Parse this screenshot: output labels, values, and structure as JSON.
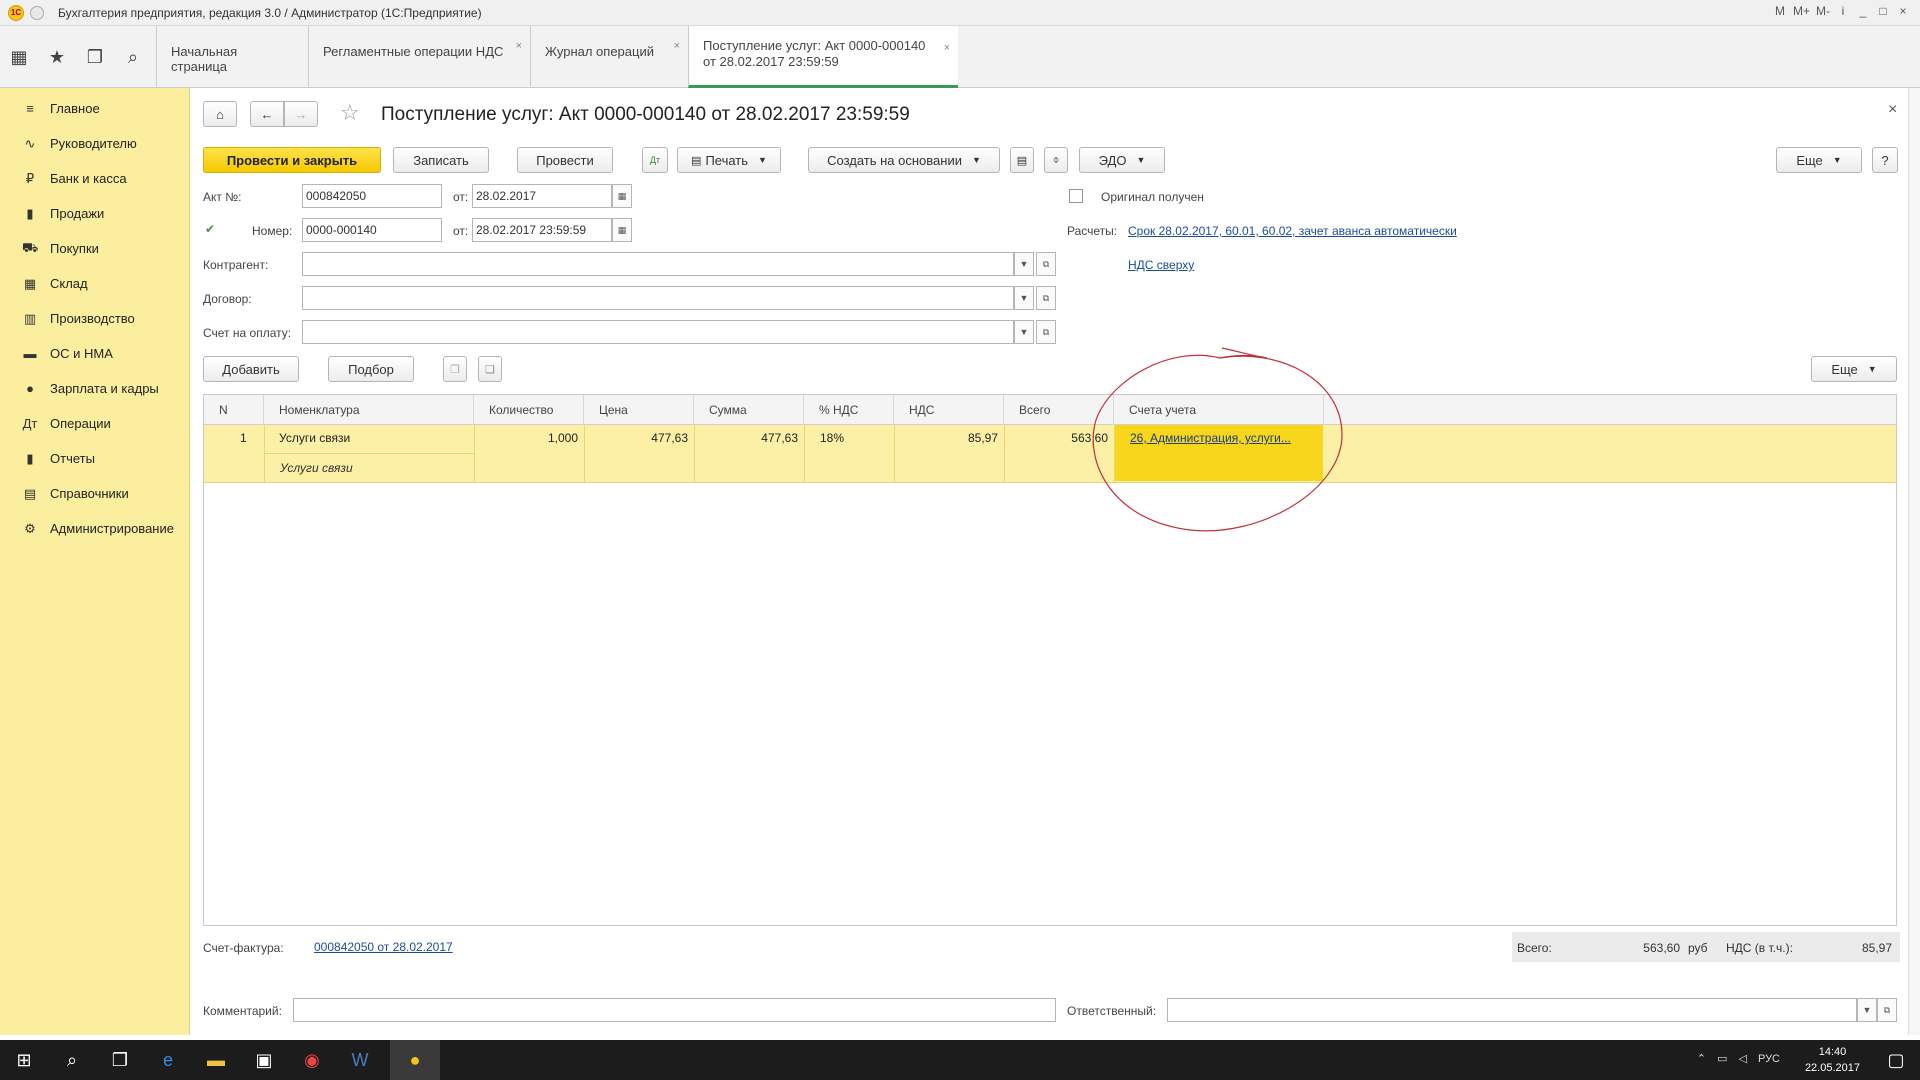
{
  "window": {
    "title": "Бухгалтерия предприятия, редакция 3.0 / Администратор  (1С:Предприятие)",
    "tools": [
      "M",
      "M+",
      "M-",
      "i",
      "_",
      "□",
      "×"
    ]
  },
  "tabs": [
    {
      "label": "Начальная страница"
    },
    {
      "label": "Регламентные операции НДС"
    },
    {
      "label": "Журнал операций"
    },
    {
      "label_line1": "Поступление услуг: Акт 0000-000140",
      "label_line2": "от 28.02.2017 23:59:59"
    }
  ],
  "tab_close": "×",
  "sidebar": {
    "items": [
      {
        "label": "Главное",
        "icon": "≡"
      },
      {
        "label": "Руководителю",
        "icon": "∿"
      },
      {
        "label": "Банк и касса",
        "icon": "₽"
      },
      {
        "label": "Продажи",
        "icon": "▮"
      },
      {
        "label": "Покупки",
        "icon": "⛟"
      },
      {
        "label": "Склад",
        "icon": "▦"
      },
      {
        "label": "Производство",
        "icon": "▥"
      },
      {
        "label": "ОС и НМА",
        "icon": "▬"
      },
      {
        "label": "Зарплата и кадры",
        "icon": "●"
      },
      {
        "label": "Операции",
        "icon": "Дт"
      },
      {
        "label": "Отчеты",
        "icon": "▮"
      },
      {
        "label": "Справочники",
        "icon": "▤"
      },
      {
        "label": "Администрирование",
        "icon": "⚙"
      }
    ]
  },
  "doc": {
    "title": "Поступление услуг: Акт 0000-000140 от 28.02.2017 23:59:59",
    "close": "×"
  },
  "toolbar": {
    "post_close": "Провести и закрыть",
    "save": "Записать",
    "post": "Провести",
    "print": "Печать",
    "create_based": "Создать на основании",
    "edo": "ЭДО",
    "more": "Еще",
    "help": "?"
  },
  "form": {
    "act_label": "Акт №:",
    "act_value": "000842050",
    "from_label": "от:",
    "act_date": "28.02.2017",
    "number_label": "Номер:",
    "number_value": "0000-000140",
    "number_date": "28.02.2017 23:59:59",
    "counterparty_label": "Контрагент:",
    "contract_label": "Договор:",
    "invoice_label": "Счет на оплату:",
    "original_label": "Оригинал получен",
    "settlements_label": "Расчеты:",
    "settlements_link": "Срок 28.02.2017, 60.01, 60.02, зачет аванса автоматически",
    "vat_link": "НДС сверху"
  },
  "table_toolbar": {
    "add": "Добавить",
    "pick": "Подбор",
    "more": "Еще"
  },
  "table": {
    "columns": [
      "N",
      "Номенклатура",
      "Количество",
      "Цена",
      "Сумма",
      "% НДС",
      "НДС",
      "Всего",
      "Счета учета"
    ],
    "rows": [
      {
        "n": "1",
        "item": "Услуги связи",
        "item_sub": "Услуги связи",
        "qty": "1,000",
        "price": "477,63",
        "sum": "477,63",
        "vat_rate": "18%",
        "vat": "85,97",
        "total": "563,60",
        "accounts": "26, Администрация, услуги..."
      }
    ]
  },
  "footer": {
    "invoice_label": "Счет-фактура:",
    "invoice_link": "000842050 от 28.02.2017",
    "total_label": "Всего:",
    "total_value": "563,60",
    "currency": "руб",
    "vat_label": "НДС (в т.ч.):",
    "vat_value": "85,97",
    "comment_label": "Комментарий:",
    "responsible_label": "Ответственный:"
  },
  "taskbar": {
    "lang": "РУС",
    "time": "14:40",
    "date": "22.05.2017"
  },
  "colors": {
    "sidebar_bg": "#fbee9e",
    "primary_btn": "#f5c800",
    "row_highlight": "#fbf0a5",
    "cell_accent": "#f8d61c",
    "link": "#1a4c9c",
    "annotation": "#c0303a"
  }
}
